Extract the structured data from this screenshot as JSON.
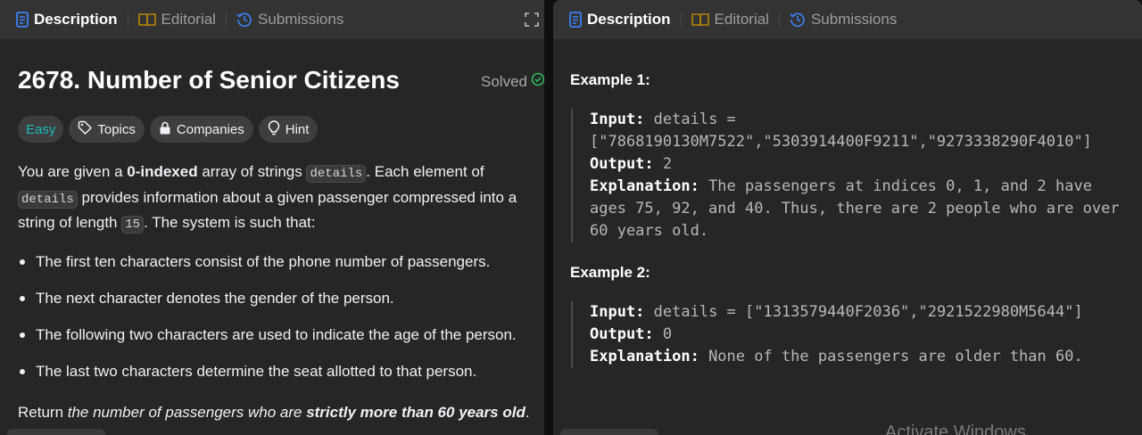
{
  "tabs": [
    {
      "label": "Description",
      "icon": "description-icon"
    },
    {
      "label": "Editorial",
      "icon": "book-icon"
    },
    {
      "label": "Submissions",
      "icon": "history-icon"
    }
  ],
  "problem": {
    "title": "2678. Number of Senior Citizens",
    "status": "Solved",
    "difficulty": "Easy",
    "chips": {
      "topics": "Topics",
      "companies": "Companies",
      "hint": "Hint"
    },
    "description": {
      "p1_a": "You are given a ",
      "p1_b": "0-indexed",
      "p1_c": " array of strings ",
      "p1_code1": "details",
      "p1_d": ". Each element of ",
      "p1_code2": "details",
      "p1_e": " provides information about a given passenger compressed into a string of length ",
      "p1_code3": "15",
      "p1_f": ". The system is such that:"
    },
    "bullets": [
      "The first ten characters consist of the phone number of passengers.",
      "The next character denotes the gender of the person.",
      "The following two characters are used to indicate the age of the person.",
      "The last two characters determine the seat allotted to that person."
    ],
    "return": {
      "a": "Return ",
      "b": "the number of passengers who are ",
      "c": "strictly more than 60 years old",
      "d": "."
    }
  },
  "examples": [
    {
      "title": "Example 1:",
      "input_label": "Input:",
      "input_line1": " details =",
      "input_line2": "[\"7868190130M7522\",\"5303914400F9211\",\"9273338290F4010\"]",
      "output_label": "Output:",
      "output": " 2",
      "explanation_label": "Explanation:",
      "explanation_line1": " The passengers at indices 0, 1, and 2 have",
      "explanation_line2": "ages 75, 92, and 40. Thus, there are 2 people who are over",
      "explanation_line3": "60 years old."
    },
    {
      "title": "Example 2:",
      "input_label": "Input:",
      "input_line1": " details = [\"1313579440F2036\",\"2921522980M5644\"]",
      "output_label": "Output:",
      "output": " 0",
      "explanation_label": "Explanation:",
      "explanation_line1": " None of the passengers are older than 60."
    }
  ],
  "watermark": "Activate Windows",
  "colors": {
    "panel": "#262626",
    "tabbar": "#333333",
    "accent_blue": "#3b82f6",
    "easy": "#1cbaba",
    "solved": "#2cbb5d",
    "editorial_icon": "#b8860b"
  }
}
